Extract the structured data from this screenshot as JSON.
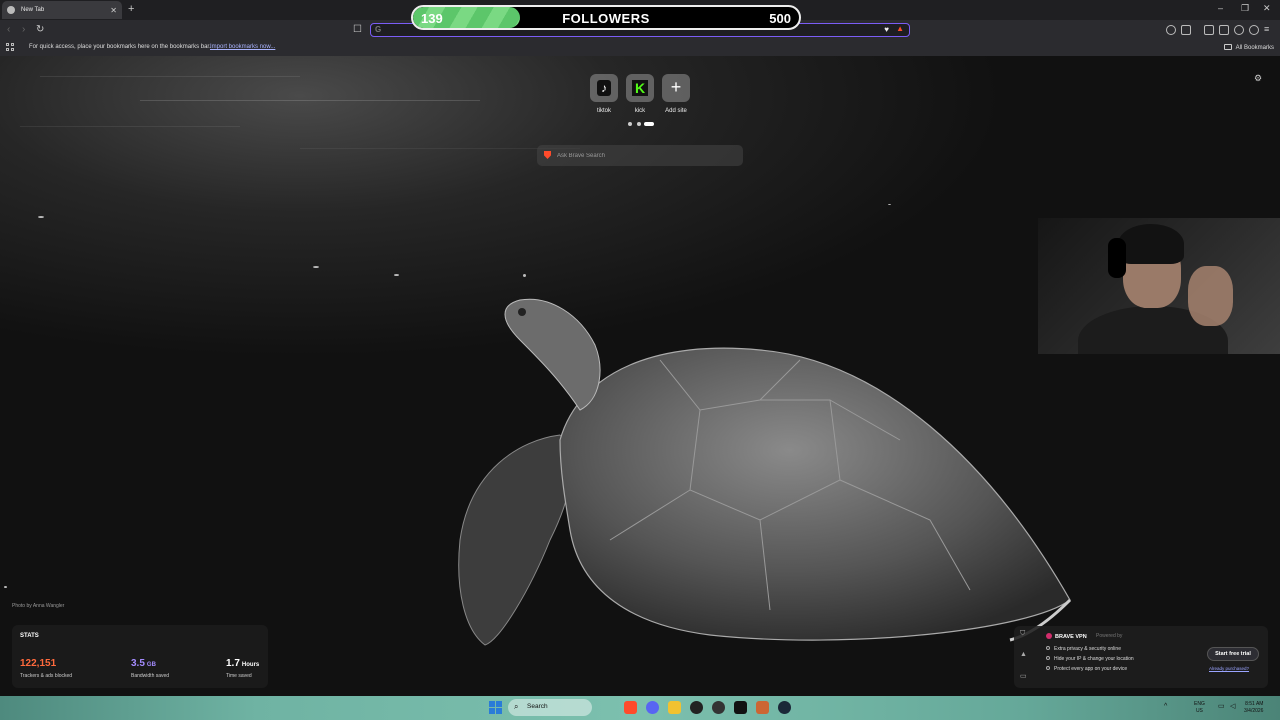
{
  "browser": {
    "tab": {
      "title": "New Tab"
    },
    "bookmarks_bar": {
      "message": "For quick access, place your bookmarks here on the bookmarks bar.",
      "import_link": "Import bookmarks now...",
      "all_bookmarks": "All Bookmarks"
    },
    "address_bar": {
      "value": ""
    }
  },
  "followers_goal": {
    "label": "FOLLOWERS",
    "current": "139",
    "goal": "500",
    "progress_fraction": 0.278
  },
  "new_tab": {
    "top_sites": [
      {
        "label": "tiktok",
        "icon": "tiktok-icon"
      },
      {
        "label": "kick",
        "icon": "kick-icon"
      },
      {
        "label": "Add site",
        "icon": "plus-icon"
      }
    ],
    "search_placeholder": "Ask Brave Search",
    "photo_credit": "Photo by Anna Wangler",
    "stats": {
      "title": "STATS",
      "items": [
        {
          "value": "122,151",
          "unit": "",
          "caption": "Trackers & ads blocked",
          "color": "#ff6a3d"
        },
        {
          "value": "3.5",
          "unit": "GB",
          "caption": "Bandwidth saved",
          "color": "#a48cff"
        },
        {
          "value": "1.7",
          "unit": "Hours",
          "caption": "Time saved",
          "color": "#ffffff"
        }
      ]
    },
    "vpn": {
      "title": "BRAVE VPN",
      "powered_by": "Powered by",
      "features": [
        "Extra privacy & security online",
        "Hide your IP & change your location",
        "Protect every app on your device"
      ],
      "cta": "Start free trial",
      "already_purchased": "Already purchased?"
    }
  },
  "taskbar": {
    "search_label": "Search",
    "lang": "ENG",
    "region": "US",
    "time": "8:51 AM",
    "date": "3/4/2026"
  },
  "colors": {
    "accent": "#7b5df6",
    "brave_orange": "#ff4b2b",
    "kick_green": "#53fc18",
    "progress_green": "#5cc66a"
  }
}
